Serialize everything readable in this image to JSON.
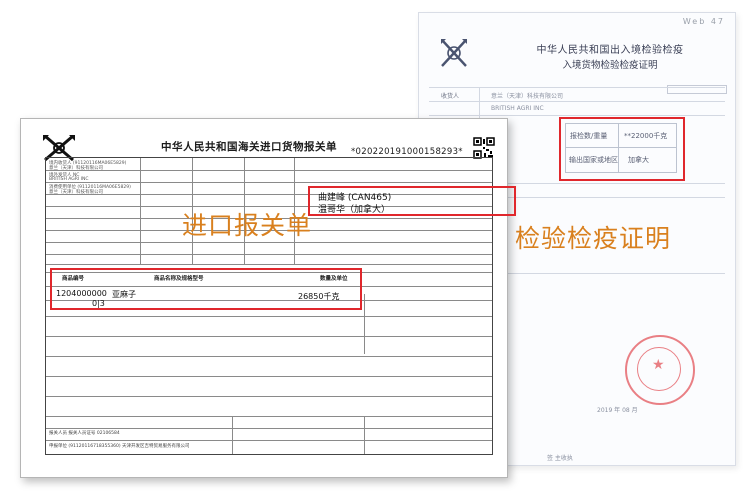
{
  "certificate": {
    "corner_mark": "Web 47",
    "title_line1": "中华人民共和国出入境检验检疫",
    "title_line2": "入境货物检验检疫证明",
    "row1_label": "收货人",
    "row1_value": "意兰（天津）科技有限公司",
    "row2_value": "BRITISH AGRI INC",
    "weight_label": "报检数/重量",
    "weight_value": "**22000千克",
    "origin_label": "输出国家或地区",
    "origin_value": "加拿大",
    "overlay_label": "检验检疫证明",
    "date_text": "2019 年 08 月",
    "signature": "签 主收执"
  },
  "declaration": {
    "title": "中华人民共和国海关进口货物报关单",
    "number": "*020220191000158293*",
    "consignor_line1": "曲建峰 (CAN465)",
    "consignor_line2": "温哥华（加拿大）",
    "goods_headers": {
      "code": "商品编号",
      "name": "商品名称及规格型号",
      "qty": "数量及单位"
    },
    "goods_code": "1204000000",
    "goods_name": "亚麻子",
    "goods_spec": "0|3",
    "goods_qty": "26850千克",
    "overlay_label": "进口报关单",
    "header_rows": [
      "境内收货人 (91120116MA06E5829)",
      "意兰（天津）科技有限公司",
      "境外发货人 NC",
      "BRITISH AGRI INC",
      "消费使用单位 (91120116MA06E5829)",
      "意兰（天津）科技有限公司"
    ],
    "footer_text1": "报关人员 报关人员证号 02106584",
    "footer_text2": "申报单位 (91120116718355360) 天津开发区吉特贸易服务有限公司"
  },
  "colors": {
    "highlight_red": "#e0272c",
    "label_orange": "#d9801e"
  }
}
